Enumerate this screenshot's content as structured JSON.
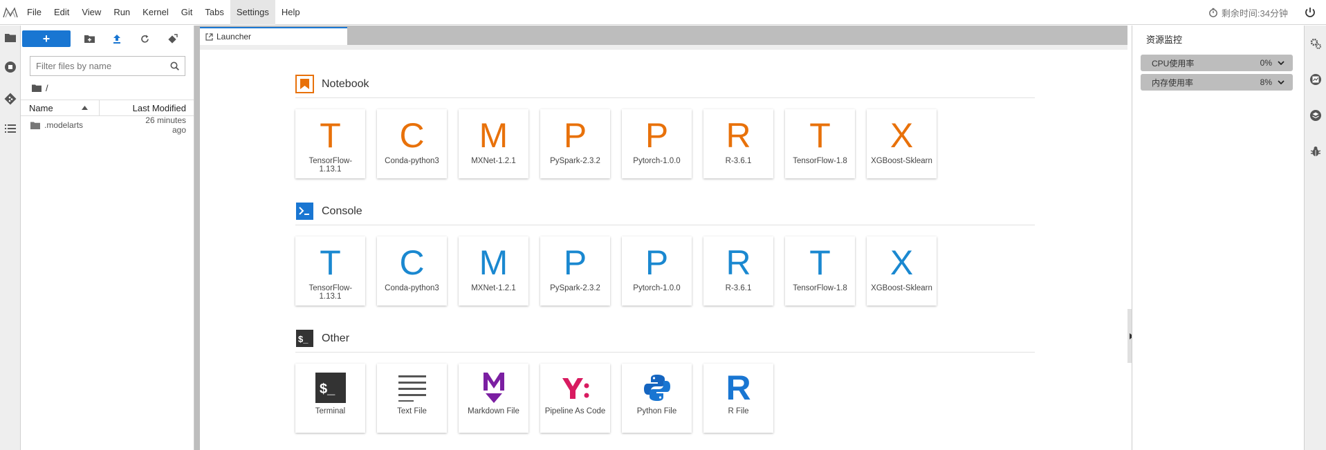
{
  "menubar": {
    "items": [
      "File",
      "Edit",
      "View",
      "Run",
      "Kernel",
      "Git",
      "Tabs",
      "Settings",
      "Help"
    ],
    "timer_text": "剩余时间:34分钟"
  },
  "filebrowser": {
    "search_placeholder": "Filter files by name",
    "breadcrumb": "/",
    "columns": {
      "name": "Name",
      "modified": "Last Modified"
    },
    "rows": [
      {
        "name": ".modelarts",
        "modified": "26 minutes ago"
      }
    ]
  },
  "tabs": {
    "launcher": "Launcher"
  },
  "launcher": {
    "notebook": {
      "title": "Notebook",
      "kernels": [
        {
          "letter": "T",
          "label": "TensorFlow-1.13.1"
        },
        {
          "letter": "C",
          "label": "Conda-python3"
        },
        {
          "letter": "M",
          "label": "MXNet-1.2.1"
        },
        {
          "letter": "P",
          "label": "PySpark-2.3.2"
        },
        {
          "letter": "P",
          "label": "Pytorch-1.0.0"
        },
        {
          "letter": "R",
          "label": "R-3.6.1"
        },
        {
          "letter": "T",
          "label": "TensorFlow-1.8"
        },
        {
          "letter": "X",
          "label": "XGBoost-Sklearn"
        }
      ]
    },
    "console": {
      "title": "Console",
      "kernels": [
        {
          "letter": "T",
          "label": "TensorFlow-1.13.1"
        },
        {
          "letter": "C",
          "label": "Conda-python3"
        },
        {
          "letter": "M",
          "label": "MXNet-1.2.1"
        },
        {
          "letter": "P",
          "label": "PySpark-2.3.2"
        },
        {
          "letter": "P",
          "label": "Pytorch-1.0.0"
        },
        {
          "letter": "R",
          "label": "R-3.6.1"
        },
        {
          "letter": "T",
          "label": "TensorFlow-1.8"
        },
        {
          "letter": "X",
          "label": "XGBoost-Sklearn"
        }
      ]
    },
    "other": {
      "title": "Other",
      "items": [
        {
          "label": "Terminal",
          "icon": "terminal-icon"
        },
        {
          "label": "Text File",
          "icon": "text-file-icon"
        },
        {
          "label": "Markdown File",
          "icon": "markdown-icon"
        },
        {
          "label": "Pipeline As Code",
          "icon": "pipeline-icon"
        },
        {
          "label": "Python File",
          "icon": "python-icon"
        },
        {
          "label": "R File",
          "icon": "r-file-icon"
        }
      ]
    }
  },
  "resource_monitor": {
    "title": "资源监控",
    "rows": [
      {
        "label": "CPU使用率",
        "value": "0%"
      },
      {
        "label": "内存使用率",
        "value": "8%"
      }
    ]
  },
  "colors": {
    "accent": "#1976d2",
    "notebook": "#e8710a",
    "console": "#1a88d0"
  }
}
